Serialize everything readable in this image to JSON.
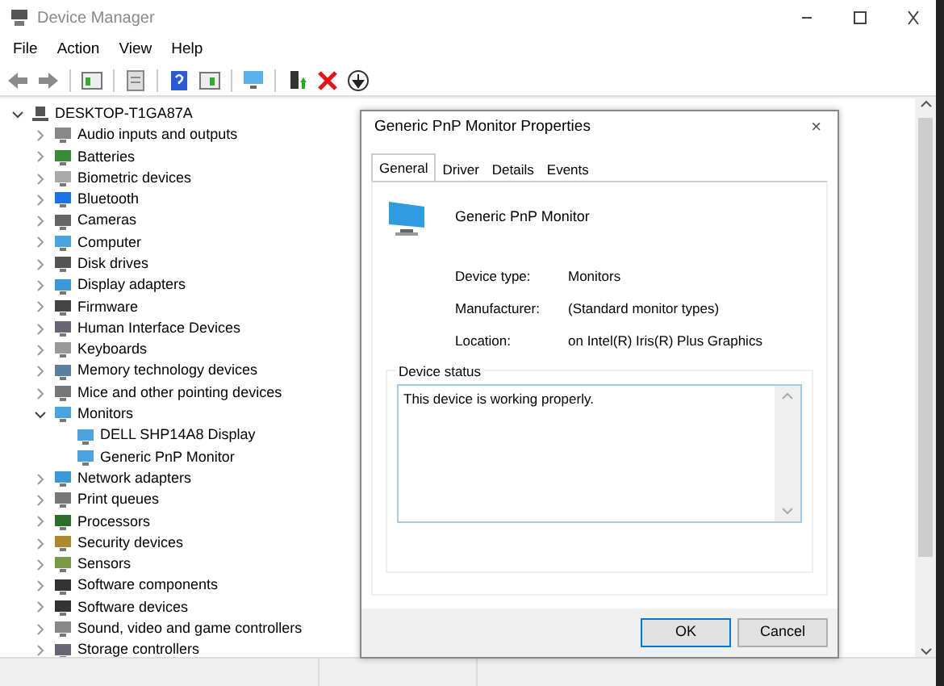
{
  "window": {
    "title": "Device Manager"
  },
  "menu": [
    "File",
    "Action",
    "View",
    "Help"
  ],
  "tree": {
    "label": "DESKTOP-T1GA87A",
    "expanded": true,
    "children": [
      {
        "label": "Audio inputs and outputs",
        "expanded": false
      },
      {
        "label": "Batteries",
        "expanded": false
      },
      {
        "label": "Biometric devices",
        "expanded": false
      },
      {
        "label": "Bluetooth",
        "expanded": false
      },
      {
        "label": "Cameras",
        "expanded": false
      },
      {
        "label": "Computer",
        "expanded": false
      },
      {
        "label": "Disk drives",
        "expanded": false
      },
      {
        "label": "Display adapters",
        "expanded": false
      },
      {
        "label": "Firmware",
        "expanded": false
      },
      {
        "label": "Human Interface Devices",
        "expanded": false
      },
      {
        "label": "Keyboards",
        "expanded": false
      },
      {
        "label": "Memory technology devices",
        "expanded": false
      },
      {
        "label": "Mice and other pointing devices",
        "expanded": false
      },
      {
        "label": "Monitors",
        "expanded": true,
        "children": [
          {
            "label": "DELL SHP14A8 Display"
          },
          {
            "label": "Generic PnP Monitor"
          }
        ]
      },
      {
        "label": "Network adapters",
        "expanded": false
      },
      {
        "label": "Print queues",
        "expanded": false
      },
      {
        "label": "Processors",
        "expanded": false
      },
      {
        "label": "Security devices",
        "expanded": false
      },
      {
        "label": "Sensors",
        "expanded": false
      },
      {
        "label": "Software components",
        "expanded": false
      },
      {
        "label": "Software devices",
        "expanded": false
      },
      {
        "label": "Sound, video and game controllers",
        "expanded": false
      },
      {
        "label": "Storage controllers",
        "expanded": false
      }
    ]
  },
  "dialog": {
    "title": "Generic PnP Monitor Properties",
    "close": "×",
    "tabs": [
      {
        "label": "General",
        "selected": true
      },
      {
        "label": "Driver",
        "selected": false
      },
      {
        "label": "Details",
        "selected": false
      },
      {
        "label": "Events",
        "selected": false
      }
    ],
    "device_name": "Generic PnP Monitor",
    "properties": [
      {
        "label": "Device type:",
        "value": "Monitors"
      },
      {
        "label": "Manufacturer:",
        "value": "(Standard monitor types)"
      },
      {
        "label": "Location:",
        "value": "on Intel(R) Iris(R) Plus Graphics"
      }
    ],
    "status_group": "Device status",
    "status_text": "This device is working properly.",
    "buttons": [
      {
        "label": "OK",
        "default": true
      },
      {
        "label": "Cancel",
        "default": false
      }
    ]
  }
}
